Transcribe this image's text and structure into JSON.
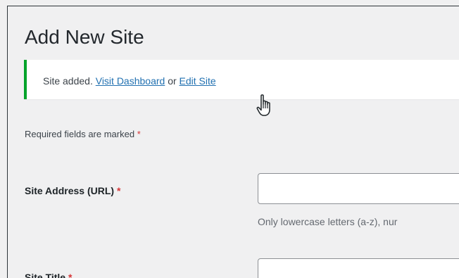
{
  "page": {
    "title": "Add New Site"
  },
  "notice": {
    "prefix": "Site added.",
    "visit_dashboard_link": "Visit Dashboard",
    "separator": "or",
    "edit_site_link": "Edit Site",
    "status_color": "#00a32a"
  },
  "form": {
    "required_note": "Required fields are marked",
    "required_marker": "*",
    "fields": [
      {
        "label": "Site Address (URL)",
        "value": "",
        "description": "Only lowercase letters (a-z), nur"
      },
      {
        "label": "Site Title",
        "value": ""
      }
    ]
  },
  "cursor": {
    "icon": "hand-pointer-icon"
  }
}
